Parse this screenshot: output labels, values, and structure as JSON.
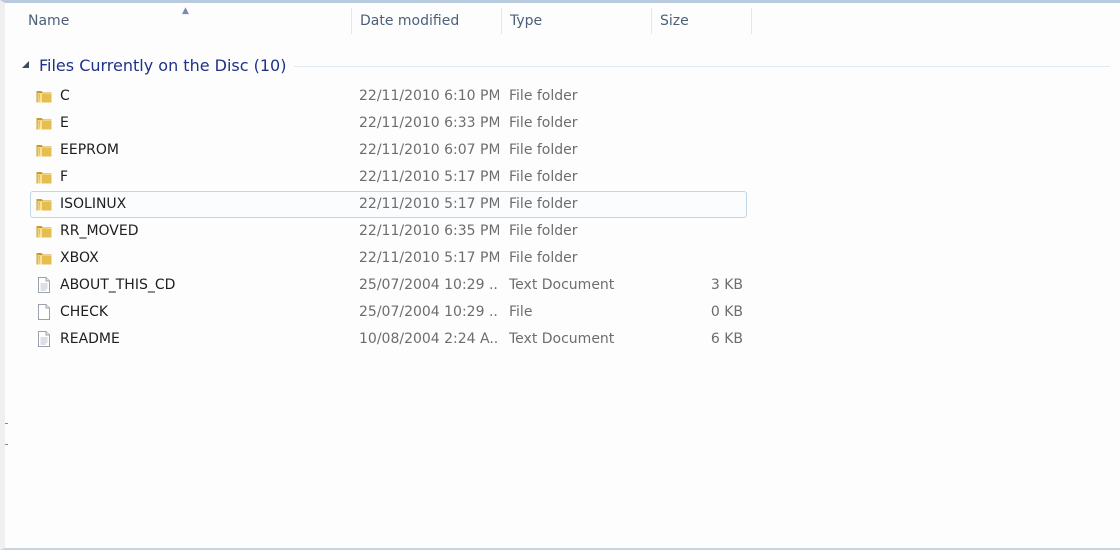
{
  "columns": {
    "name": "Name",
    "date_modified": "Date modified",
    "type": "Type",
    "size": "Size"
  },
  "group": {
    "title": "Files Currently on the Disc (10)"
  },
  "colors": {
    "group_title": "#1e3287",
    "header_text": "#4c607a",
    "folder_body": "#e8c15a",
    "hover_border": "#c3d5ea"
  },
  "files": [
    {
      "name": "C",
      "date": "22/11/2010 6:10 PM",
      "type": "File folder",
      "size": "",
      "icon": "folder-icon"
    },
    {
      "name": "E",
      "date": "22/11/2010 6:33 PM",
      "type": "File folder",
      "size": "",
      "icon": "folder-icon"
    },
    {
      "name": "EEPROM",
      "date": "22/11/2010 6:07 PM",
      "type": "File folder",
      "size": "",
      "icon": "folder-icon"
    },
    {
      "name": "F",
      "date": "22/11/2010 5:17 PM",
      "type": "File folder",
      "size": "",
      "icon": "folder-icon"
    },
    {
      "name": "ISOLINUX",
      "date": "22/11/2010 5:17 PM",
      "type": "File folder",
      "size": "",
      "icon": "folder-icon"
    },
    {
      "name": "RR_MOVED",
      "date": "22/11/2010 6:35 PM",
      "type": "File folder",
      "size": "",
      "icon": "folder-icon"
    },
    {
      "name": "XBOX",
      "date": "22/11/2010 5:17 PM",
      "type": "File folder",
      "size": "",
      "icon": "folder-icon"
    },
    {
      "name": "ABOUT_THIS_CD",
      "date": "25/07/2004 10:29 ...",
      "type": "Text Document",
      "size": "3 KB",
      "icon": "text-document-icon"
    },
    {
      "name": "CHECK",
      "date": "25/07/2004 10:29 ...",
      "type": "File",
      "size": "0 KB",
      "icon": "blank-file-icon"
    },
    {
      "name": "README",
      "date": "10/08/2004 2:24 A...",
      "type": "Text Document",
      "size": "6 KB",
      "icon": "text-document-icon"
    }
  ]
}
